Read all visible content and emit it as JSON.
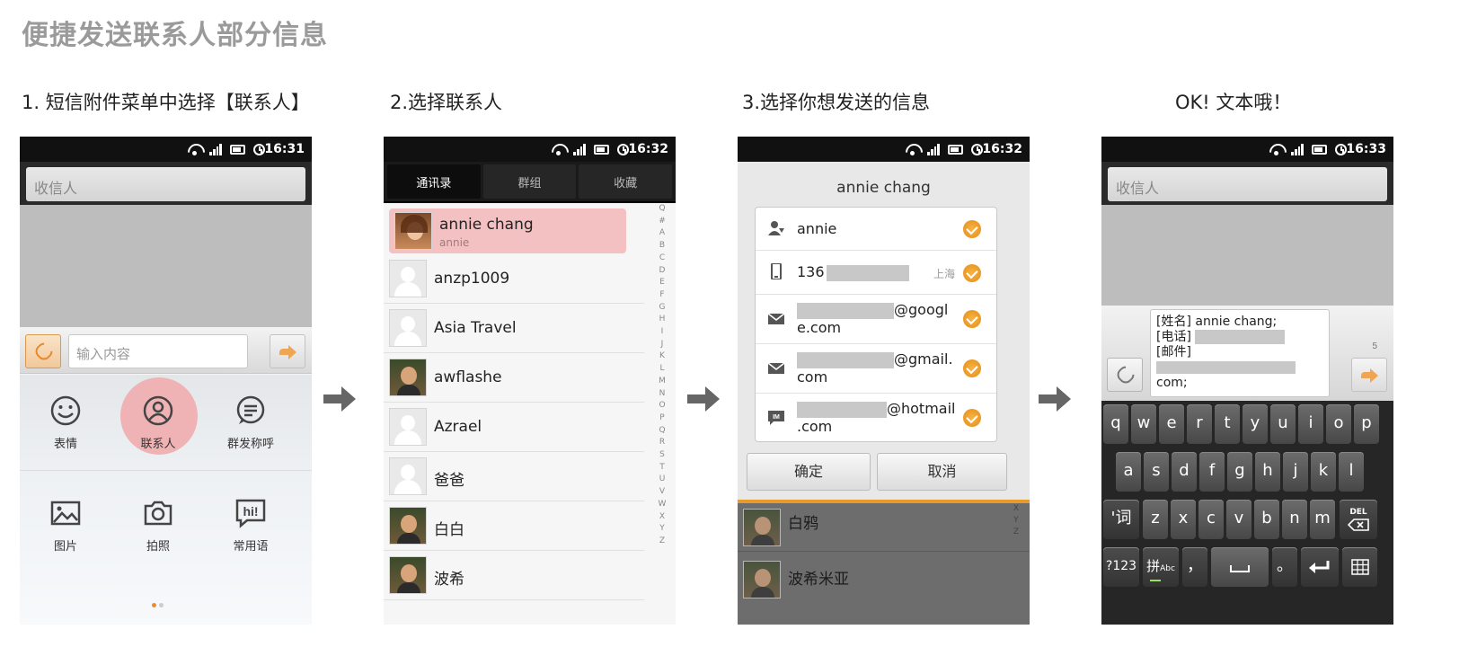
{
  "page": {
    "title": "便捷发送联系人部分信息",
    "steps": [
      "1. 短信附件菜单中选择【联系人】",
      "2.选择联系人",
      "3.选择你想发送的信息",
      "OK! 文本哦！"
    ]
  },
  "phone1": {
    "time": "16:31",
    "recipient_placeholder": "收信人",
    "message_placeholder": "输入内容",
    "attachments": [
      {
        "label": "表情",
        "icon": "emoji-icon"
      },
      {
        "label": "联系人",
        "icon": "contact-icon",
        "selected": true
      },
      {
        "label": "群发称呼",
        "icon": "group-salutation-icon"
      },
      {
        "label": "图片",
        "icon": "image-icon"
      },
      {
        "label": "拍照",
        "icon": "camera-icon"
      },
      {
        "label": "常用语",
        "icon": "phrases-icon"
      }
    ],
    "phrases_icon_text": "hi!"
  },
  "phone2": {
    "time": "16:32",
    "tabs": [
      "通讯录",
      "群组",
      "收藏"
    ],
    "contacts": [
      {
        "name": "annie chang",
        "sub": "annie",
        "selected": true
      },
      {
        "name": "anzp1009"
      },
      {
        "name": "Asia Travel"
      },
      {
        "name": "awflashe"
      },
      {
        "name": "Azrael"
      },
      {
        "name": "爸爸"
      },
      {
        "name": "白白"
      },
      {
        "name": "波希"
      }
    ],
    "index": [
      "Q",
      "#",
      "A",
      "B",
      "C",
      "D",
      "E",
      "F",
      "G",
      "H",
      "I",
      "J",
      "K",
      "L",
      "M",
      "N",
      "O",
      "P",
      "Q",
      "R",
      "S",
      "T",
      "U",
      "V",
      "W",
      "X",
      "Y",
      "Z"
    ]
  },
  "phone3": {
    "time": "16:32",
    "dialog_title": "annie chang",
    "options": [
      {
        "line1": "annie",
        "icon": "contact-name-icon"
      },
      {
        "line1": "136",
        "location": "上海",
        "icon": "mobile-phone-icon"
      },
      {
        "line1": "@googl",
        "line2": "e.com",
        "icon": "mail-icon"
      },
      {
        "line1": "@gmail.",
        "line2": "com",
        "icon": "mail-icon"
      },
      {
        "line1": "@hotmail",
        "line2": ".com",
        "icon": "im-icon",
        "icon_text": "IM"
      }
    ],
    "confirm": "确定",
    "cancel": "取消",
    "background_contacts": [
      "白鸦",
      "波希米亚"
    ],
    "background_index": [
      "X",
      "Y",
      "Z"
    ]
  },
  "phone4": {
    "time": "16:33",
    "recipient_placeholder": "收信人",
    "message_lines": [
      "[姓名] annie chang;",
      "[电话]",
      "[邮件]",
      "com;"
    ],
    "char_count": "5",
    "keys_row1": [
      "q",
      "w",
      "e",
      "r",
      "t",
      "y",
      "u",
      "i",
      "o",
      "p"
    ],
    "keys_row2": [
      "a",
      "s",
      "d",
      "f",
      "g",
      "h",
      "j",
      "k",
      "l"
    ],
    "keys_row3": [
      "z",
      "x",
      "c",
      "v",
      "b",
      "n",
      "m"
    ],
    "key_word": "'词",
    "key_del": "DEL",
    "key_123": "?123",
    "key_pinyin": "拼",
    "key_pinyin_sub": "Abc",
    "key_comma": "，",
    "key_period": "。"
  }
}
